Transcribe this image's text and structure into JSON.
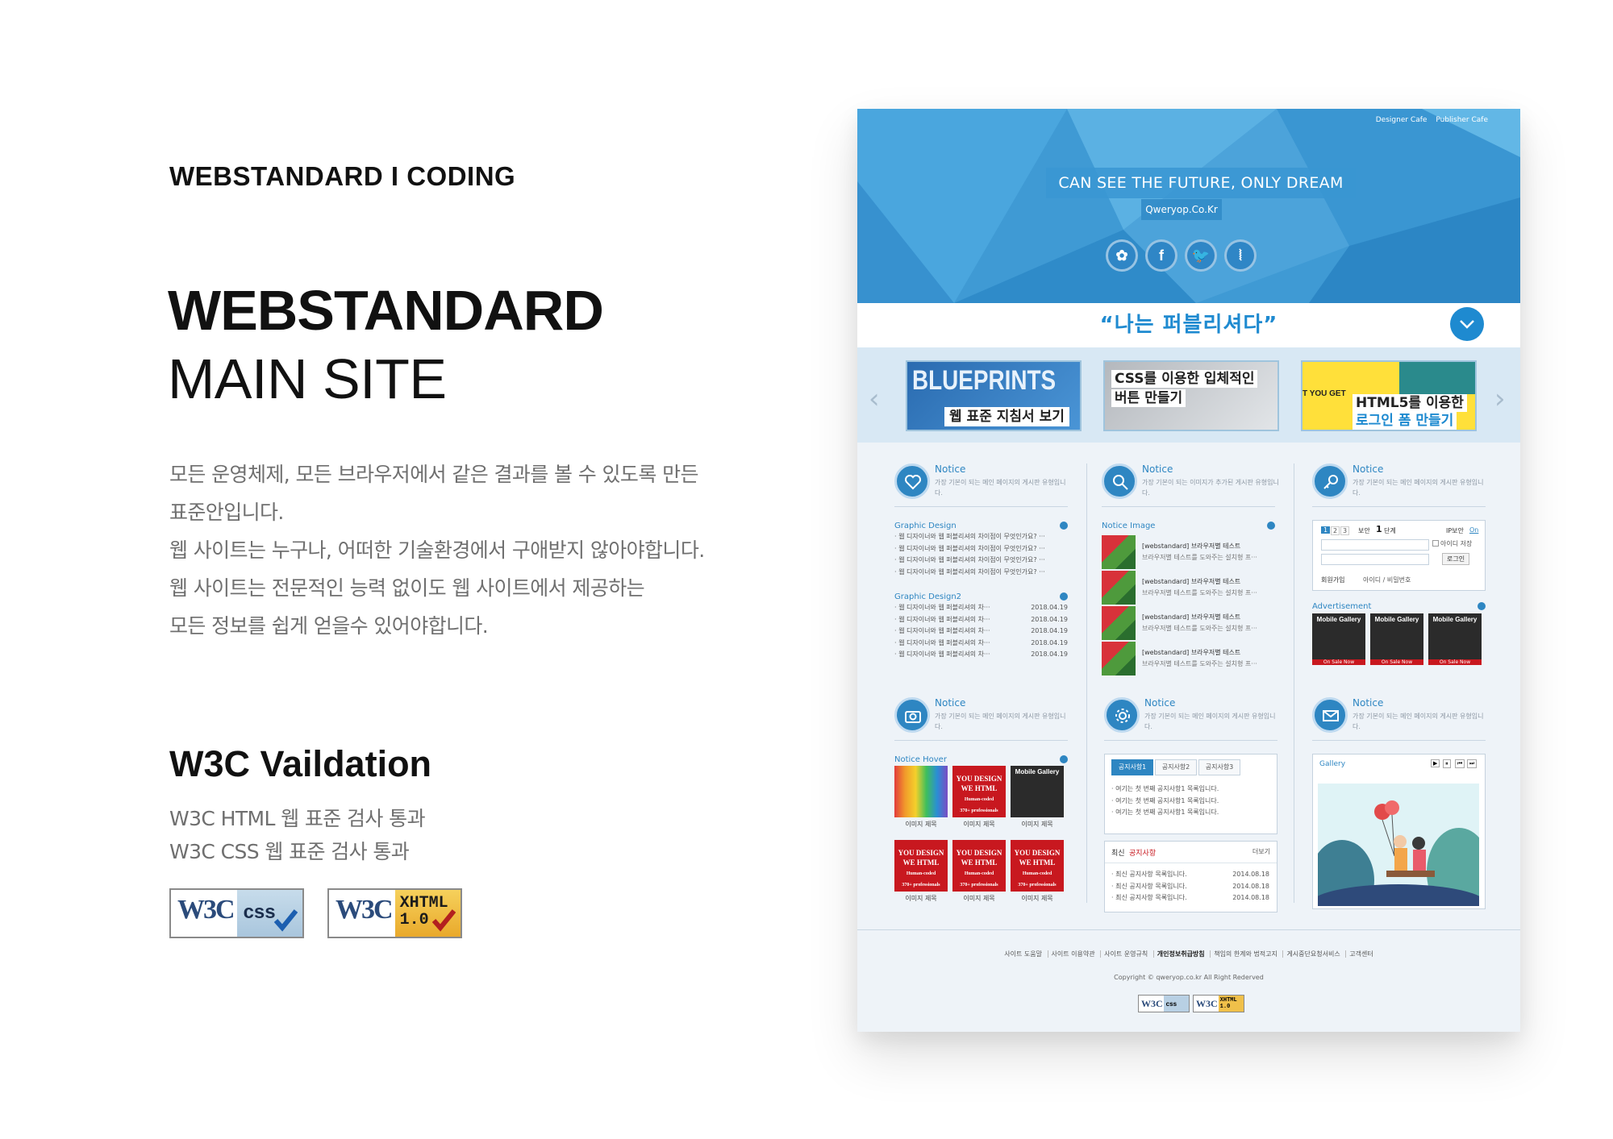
{
  "left": {
    "kicker": "WEBSTANDARD I CODING",
    "title_line1": "WEBSTANDARD",
    "title_line2": "MAIN SITE",
    "description": [
      "모든 운영체제, 모든 브라우저에서 같은 결과를 볼 수 있도록 만든",
      "표준안입니다.",
      "웹 사이트는 누구나, 어떠한 기술환경에서 구애받지 않아야합니다.",
      "웹 사이트는 전문적인 능력 없이도 웹 사이트에서 제공하는",
      "모든 정보를 쉽게 얻을수 있어야합니다."
    ],
    "w3c_title": "W3C Vaildation",
    "w3c_lines": [
      "W3C HTML 웹 표준 검사 통과",
      "W3C CSS 웹 표준 검사 통과"
    ],
    "badges": {
      "css": {
        "w3": "W3C",
        "label": "css"
      },
      "xhtml": {
        "w3": "W3C",
        "label1": "XHTML",
        "label2": "1.0"
      }
    }
  },
  "mock": {
    "top_links": [
      "Designer Cafe",
      "Publisher Cafe"
    ],
    "slogan": "CAN SEE THE FUTURE, ONLY DREAM",
    "domain": "Qweryop.Co.Kr",
    "social": [
      "flickr-icon",
      "facebook-icon",
      "twitter-icon",
      "rss-icon"
    ],
    "tagline": "“나는 퍼블리셔다”",
    "slides": [
      {
        "big": "BLUEPRINTS",
        "cap": "웹 표준 지침서 보기"
      },
      {
        "l1": "CSS를 이용한 입체적인",
        "l2": "버튼 만들기"
      },
      {
        "side": "T YOU GET",
        "l1": "HTML5를 이용한",
        "l2": "로그인 폼 만들기"
      }
    ],
    "panel_title": "Notice",
    "panel_descs": [
      "가장 기본이 되는 메인 페이지의 게시판 유형입니다.",
      "가장 기본이 되는 이미지가 추가된 게시판 유형입니다.",
      "가장 기본이 되는 메인 페이지의 게시판 유형입니다.",
      "가장 기본이 되는 메인 페이지의 게시판 유형입니다.",
      "가장 기본이 되는 메인 페이지의 게시판 유형입니다.",
      "가장 기본이 되는 메인 페이지의 게시판 유형입니다."
    ],
    "p1": {
      "sec1": "Graphic Design",
      "list1": [
        "· 웹 디자이너와 웹 퍼블리셔의 차이점이 무엇인가요? ···",
        "· 웹 디자이너와 웹 퍼블리셔의 차이점이 무엇인가요? ···",
        "· 웹 디자이너와 웹 퍼블리셔의 차이점이 무엇인가요? ···",
        "· 웹 디자이너와 웹 퍼블리셔의 차이점이 무엇인가요? ···"
      ],
      "sec2": "Graphic Design2",
      "list2": [
        {
          "t": "· 웹 디자이너와 웹 퍼블리셔의 차···",
          "d": "2018.04.19"
        },
        {
          "t": "· 웹 디자이너와 웹 퍼블리셔의 차···",
          "d": "2018.04.19"
        },
        {
          "t": "· 웹 디자이너와 웹 퍼블리셔의 차···",
          "d": "2018.04.19"
        },
        {
          "t": "· 웹 디자이너와 웹 퍼블리셔의 차···",
          "d": "2018.04.19"
        },
        {
          "t": "· 웹 디자이너와 웹 퍼블리셔의 차···",
          "d": "2018.04.19"
        }
      ]
    },
    "p2": {
      "sec": "Notice Image",
      "items": [
        {
          "t1": "[webstandard] 브라우저별 테스트",
          "t2": "브라우저별 테스트를 도와주는 설치형 프···"
        },
        {
          "t1": "[webstandard] 브라우저별 테스트",
          "t2": "브라우저별 테스트를 도와주는 설치형 프···"
        },
        {
          "t1": "[webstandard] 브라우저별 테스트",
          "t2": "브라우저별 테스트를 도와주는 설치형 프···"
        },
        {
          "t1": "[webstandard] 브라우저별 테스트",
          "t2": "브라우저별 테스트를 도와주는 설치형 프···"
        }
      ]
    },
    "p3": {
      "pages": [
        "1",
        "2",
        "3"
      ],
      "security": "보안",
      "level": "1",
      "level_unit": "단계",
      "ip_label": "IP보안",
      "ip_on": "On",
      "save_id": "아이디 저장",
      "login": "로그인",
      "join": "회원가입",
      "find": "아이디 / 비밀번호",
      "sec": "Advertisement",
      "ad_title": "Mobile Gallery",
      "ad_sale": "On Sale Now"
    },
    "p4": {
      "sec": "Notice Hover",
      "mobile_title": "Mobile Gallery",
      "red_l1": "YOU DESIGN",
      "red_l2": "WE HTML",
      "red_l3": "Human-coded",
      "red_l4": "370+ professionals",
      "caption": "이미지 제목"
    },
    "p5": {
      "tabs": [
        "공지사항1",
        "공지사항2",
        "공지사항3"
      ],
      "tab_items": [
        "· 여기는 첫 번째 공지사항1 목록입니다.",
        "· 여기는 첫 번째 공지사항1 목록입니다.",
        "· 여기는 첫 번째 공지사항1 목록입니다."
      ],
      "recent_prefix": "최신",
      "recent_title": "공지사항",
      "more": "더보기",
      "recent": [
        {
          "t": "· 최신 공지사항 목록입니다.",
          "d": "2014.08.18"
        },
        {
          "t": "· 최신 공지사항 목록입니다.",
          "d": "2014.08.18"
        },
        {
          "t": "· 최신 공지사항 목록입니다.",
          "d": "2014.08.18"
        }
      ]
    },
    "p6": {
      "sec": "Gallery",
      "controls": [
        "▶",
        "⏸",
        "⏮",
        "⏭"
      ]
    },
    "footer_links": [
      "사이트 도움말",
      "사이트 이용약관",
      "사이트 운영규칙",
      "개인정보취급방침",
      "책임의 한계와 법적고지",
      "게시중단요청서비스",
      "고객센터"
    ],
    "copyright": "Copyright © qweryop.co.kr All Right Rederved",
    "colors": {
      "accent": "#2e86c2",
      "hero": "#3f9ad4",
      "background": "#eef3f8"
    }
  }
}
